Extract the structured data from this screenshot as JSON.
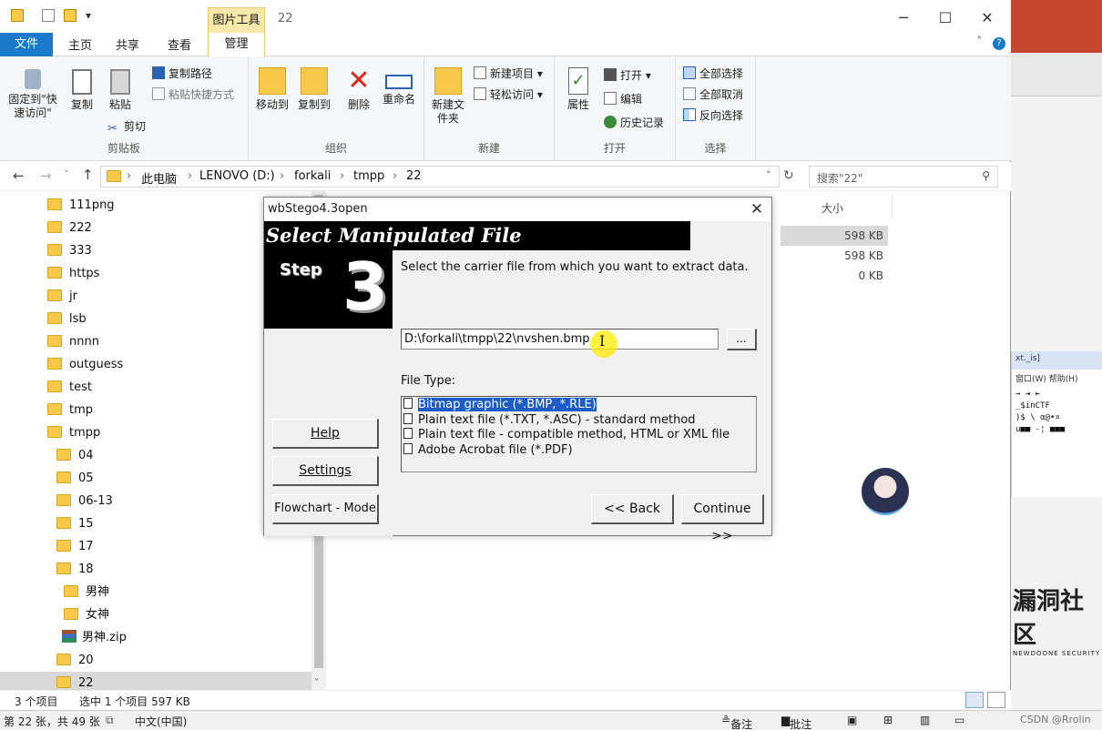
{
  "explorer": {
    "contextual_tab": "图片工具",
    "window_title": "22",
    "tabs": [
      "文件",
      "主页",
      "共享",
      "查看",
      "管理"
    ],
    "ribbon": {
      "clipboard": {
        "label": "剪贴板",
        "pin": "固定到\"快速访问\"",
        "copy": "复制",
        "paste": "粘贴",
        "copy_path": "复制路径",
        "paste_shortcut": "粘贴快捷方式",
        "cut": "剪切"
      },
      "organize": {
        "label": "组织",
        "move_to": "移动到",
        "copy_to": "复制到",
        "delete": "删除",
        "rename": "重命名"
      },
      "new": {
        "label": "新建",
        "new_folder": "新建文件夹",
        "new_item": "新建项目",
        "easy_access": "轻松访问"
      },
      "open": {
        "label": "打开",
        "properties": "属性",
        "open": "打开",
        "edit": "编辑",
        "history": "历史记录"
      },
      "select": {
        "label": "选择",
        "select_all": "全部选择",
        "select_none": "全部取消",
        "invert": "反向选择"
      }
    },
    "address": [
      "此电脑",
      "LENOVO (D:)",
      "forkali",
      "tmpp",
      "22"
    ],
    "search_placeholder": "搜索\"22\"",
    "tree": [
      "111png",
      "222",
      "333",
      "https",
      "jr",
      "lsb",
      "nnnn",
      "outguess",
      "test",
      "tmp",
      "tmpp",
      "04",
      "05",
      "06-13",
      "15",
      "17",
      "18",
      "男神",
      "女神",
      "男神.zip",
      "20",
      "22"
    ],
    "size_header": "大小",
    "sizes": [
      "598 KB",
      "598 KB",
      "0 KB"
    ],
    "status": {
      "items": "3 个项目",
      "selected": "选中 1 个项目 597 KB"
    }
  },
  "taskbar": {
    "left": "第 22 张，共 49 张",
    "lang": "中文(中国)",
    "notes": "备注",
    "comments": "批注",
    "watermark": "CSDN @Rrolin"
  },
  "background": {
    "editor_title": "xt._is]",
    "menu": "窗口(W)  帮助(H)",
    "logo": "漏洞社区",
    "logo_sub": "NEWDOONE SECURITY"
  },
  "dialog": {
    "title": "wbStego4.3open",
    "banner": "Select Manipulated File",
    "step_label": "Step",
    "step_num": "3",
    "instruction": "Select the carrier file from which you want to extract data.",
    "file_path": "D:\\forkali\\tmpp\\22\\nvshen.bmp",
    "browse": "...",
    "file_type_label": "File Type:",
    "file_types": [
      "Bitmap graphic (*.BMP, *.RLE)",
      "Plain text file (*.TXT, *.ASC) - standard method",
      "Plain text file - compatible method, HTML or XML file",
      "Adobe Acrobat file (*.PDF)"
    ],
    "help": "Help",
    "settings": "Settings",
    "flowchart": "Flowchart - Mode",
    "back": "<< Back",
    "continue": "Continue >>"
  }
}
